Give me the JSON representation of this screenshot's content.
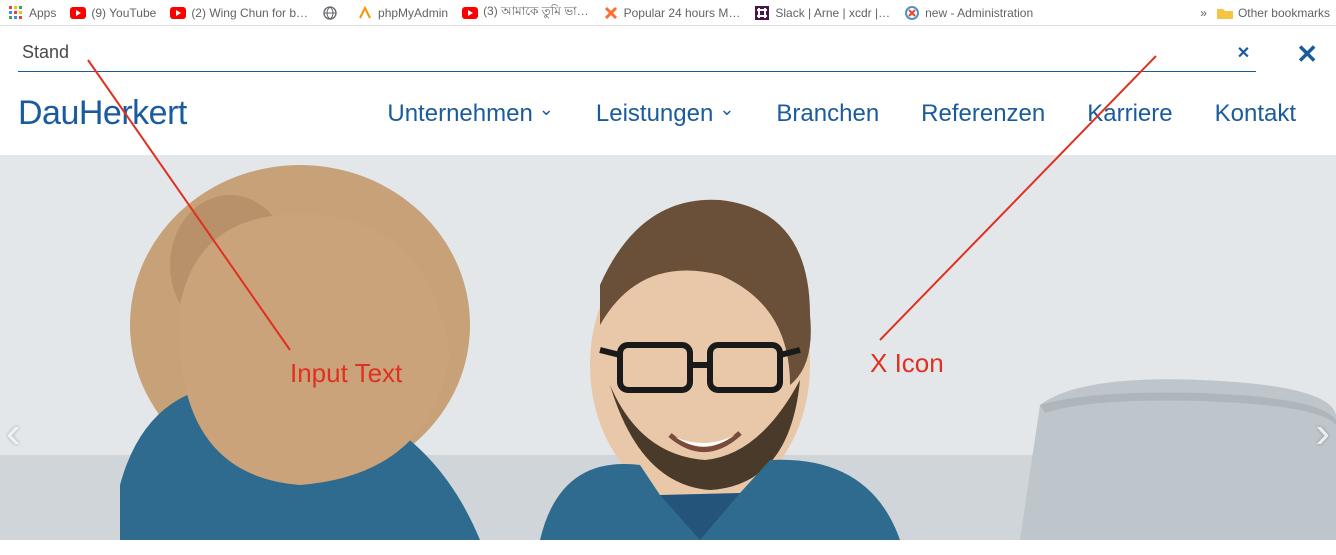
{
  "bookmarks": {
    "apps": "Apps",
    "items": [
      "(9) YouTube",
      "(2) Wing Chun for b…",
      "",
      "phpMyAdmin",
      "(3) আমাকে তুমি ভা…",
      "Popular 24 hours M…",
      "Slack | Arne | xcdr |…",
      "new - Administration"
    ],
    "more": "»",
    "other": "Other bookmarks"
  },
  "search": {
    "value": "Stand "
  },
  "logo": {
    "prefix": "Dau",
    "rest": "Herkert"
  },
  "nav": {
    "items": [
      {
        "label": "Unternehmen",
        "dropdown": true
      },
      {
        "label": "Leistungen",
        "dropdown": true
      },
      {
        "label": "Branchen",
        "dropdown": false
      },
      {
        "label": "Referenzen",
        "dropdown": false
      },
      {
        "label": "Karriere",
        "dropdown": false
      },
      {
        "label": "Kontakt",
        "dropdown": false
      }
    ]
  },
  "annotations": {
    "input": "Input Text",
    "xicon": "X Icon"
  },
  "colors": {
    "brand": "#1a5b9e",
    "ann": "#e03020"
  }
}
